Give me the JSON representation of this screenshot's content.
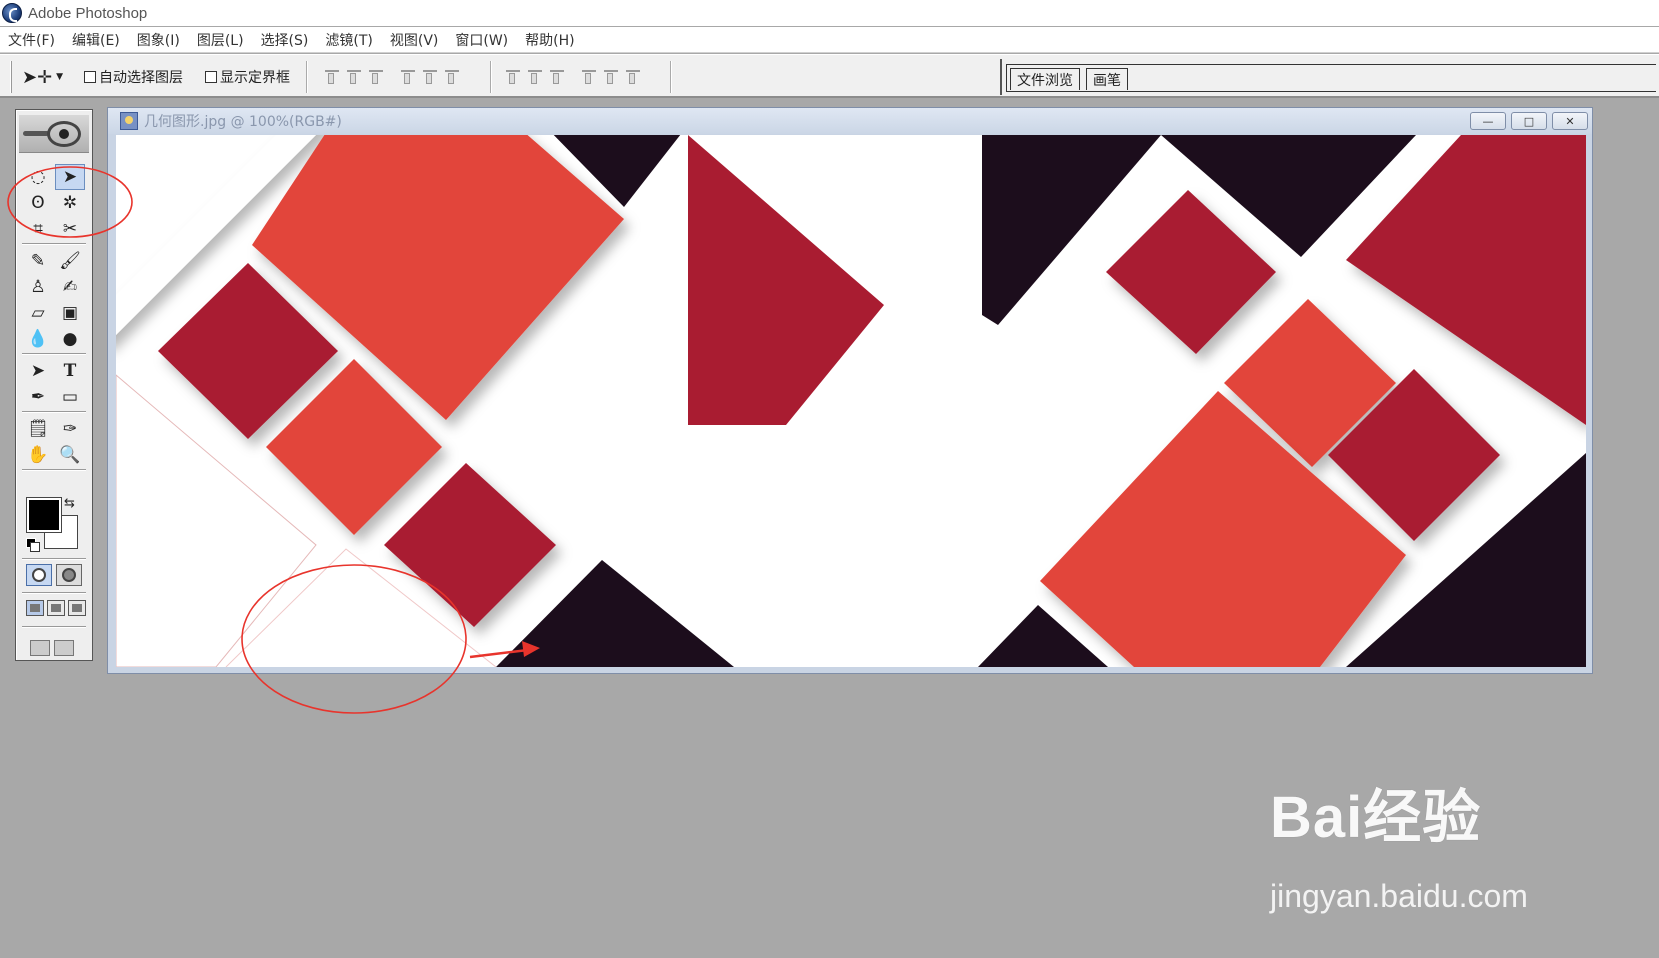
{
  "app": {
    "title": "Adobe Photoshop"
  },
  "menu": {
    "items": [
      "文件(F)",
      "编辑(E)",
      "图象(I)",
      "图层(L)",
      "选择(S)",
      "滤镜(T)",
      "视图(V)",
      "窗口(W)",
      "帮助(H)"
    ]
  },
  "options": {
    "auto_select_layer": "自动选择图层",
    "show_bounding_box": "显示定界框"
  },
  "palette_well": {
    "tabs": [
      "文件浏览",
      "画笔"
    ]
  },
  "document": {
    "title": "几何图形.jpg @ 100%(RGB#)",
    "controls": {
      "minimize": "—",
      "maximize": "□",
      "close": "✕"
    }
  },
  "toolbox": {
    "foreground_color": "#000000",
    "background_color": "#ffffff"
  },
  "canvas_colors": {
    "coral": "#e2453a",
    "crimson": "#a91c31",
    "dark": "#1c0d1c",
    "white": "#ffffff"
  },
  "annotation_color": "#e8342c",
  "watermark": {
    "logo": "Bai经验",
    "url": "jingyan.baidu.com"
  }
}
